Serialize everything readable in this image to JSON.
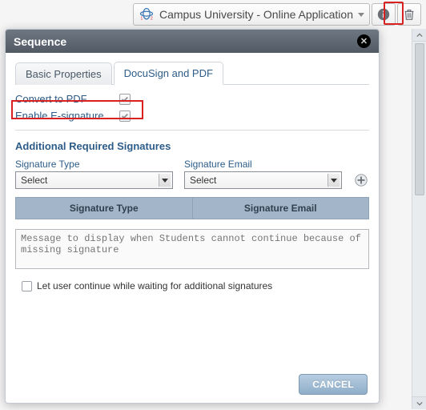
{
  "topbar": {
    "app_label": "Campus University - Online Application"
  },
  "dialog": {
    "title": "Sequence",
    "tabs": {
      "basic": "Basic Properties",
      "docusign": "DocuSign and PDF"
    },
    "options": {
      "convert_pdf_label": "Convert to PDF",
      "convert_pdf_checked": true,
      "enable_esig_label": "Enable E-signature",
      "enable_esig_checked": true
    },
    "section_title": "Additional Required Signatures",
    "signature_type": {
      "label": "Signature Type",
      "selected": "Select"
    },
    "signature_email": {
      "label": "Signature Email",
      "selected": "Select"
    },
    "table_headers": {
      "type": "Signature Type",
      "email": "Signature Email"
    },
    "message_placeholder": "Message to display when Students cannot continue because of missing signature",
    "let_continue_label": "Let user continue while waiting for additional signatures",
    "let_continue_checked": false,
    "cancel_label": "CANCEL"
  }
}
